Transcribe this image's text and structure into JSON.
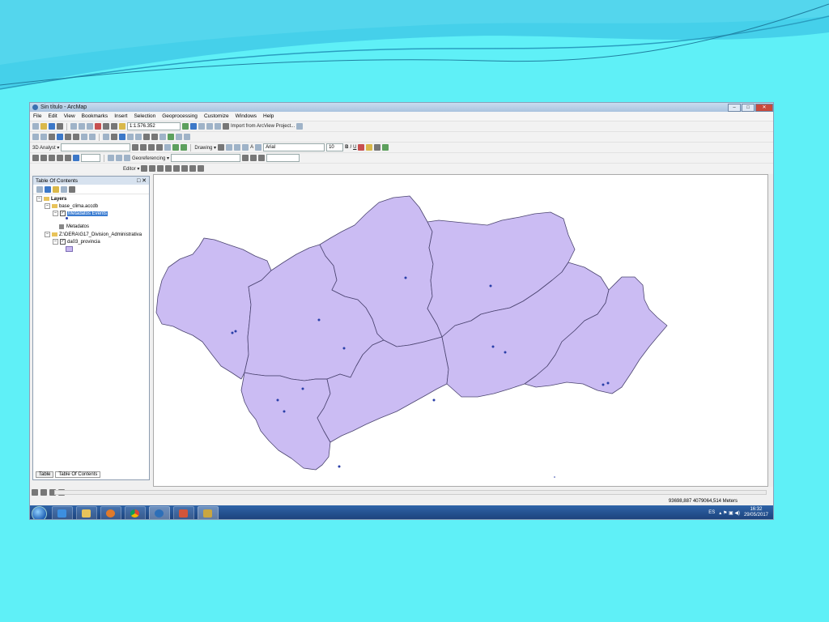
{
  "window": {
    "title": "Sin título - ArcMap",
    "controls": [
      "–",
      "□",
      "✕"
    ]
  },
  "menu": [
    "File",
    "Edit",
    "View",
    "Bookmarks",
    "Insert",
    "Selection",
    "Geoprocessing",
    "Customize",
    "Windows",
    "Help"
  ],
  "toolbar": {
    "scale": "1:1.576.352",
    "import_label": "Import from ArcView Project...",
    "analyst_3d": "3D Analyst ▾",
    "drawing": "Drawing ▾",
    "font_name": "Arial",
    "font_size": "10",
    "bold": "B",
    "italic": "I",
    "underline": "U",
    "georeferencing": "Georeferencing ▾",
    "editor": "Editor ▾"
  },
  "toc": {
    "title": "Table Of Contents",
    "header_buttons": "□ ✕",
    "layers_root": "Layers",
    "items": [
      {
        "label": "base_clima.accdb"
      },
      {
        "label": "Metadatos Events"
      },
      {
        "label": "Metadatos"
      },
      {
        "label": "Z:\\DERA\\G17_Division_Administrativa"
      },
      {
        "label": "da03_provincia"
      }
    ],
    "tabs": [
      "Table",
      "Table Of Contents"
    ]
  },
  "status": {
    "coordinates": "93698,887  4079064,514 Meters"
  },
  "taskbar": {
    "apps": [
      "explorer",
      "ie",
      "folder",
      "media",
      "chrome",
      "arcgis",
      "powerpoint",
      "arcmap"
    ],
    "language": "ES",
    "time": "16:32",
    "date": "29/05/2017"
  },
  "colors": {
    "background": "#5ff0f7",
    "province_fill": "#cbbcf3",
    "province_stroke": "#4b4470",
    "point": "#2a3fa8"
  }
}
